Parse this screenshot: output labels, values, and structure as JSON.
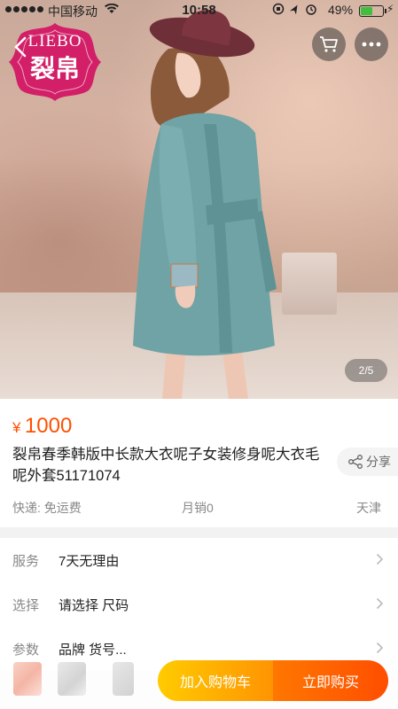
{
  "status_bar": {
    "carrier": "中国移动",
    "time": "10:58",
    "battery": "49%",
    "battery_level": 0.49
  },
  "brand": {
    "logo_text": "LIEBO",
    "logo_glyph": "裂帛"
  },
  "header": {
    "back_icon": "chevron-left-icon",
    "cart_icon": "cart-icon",
    "more_icon": "more-dots-icon"
  },
  "gallery": {
    "pager": "2/5"
  },
  "product": {
    "currency": "¥",
    "price": "1000",
    "title": "裂帛春季韩版中长款大衣呢子女装修身呢大衣毛呢外套51171074",
    "share_label": "分享",
    "shipping": "快递: 免运费",
    "monthly_sales": "月销0",
    "location": "天津"
  },
  "rows": [
    {
      "label": "服务",
      "value": "7天无理由"
    },
    {
      "label": "选择",
      "value": "请选择 尺码"
    },
    {
      "label": "参数",
      "value": "品牌 货号..."
    }
  ],
  "actions": {
    "add_to_cart": "加入购物车",
    "buy_now": "立即购买"
  },
  "colors": {
    "accent": "#ff5000",
    "cart_button": "#ffb300",
    "buy_button": "#ff5a00",
    "logo": "#d21f67"
  }
}
